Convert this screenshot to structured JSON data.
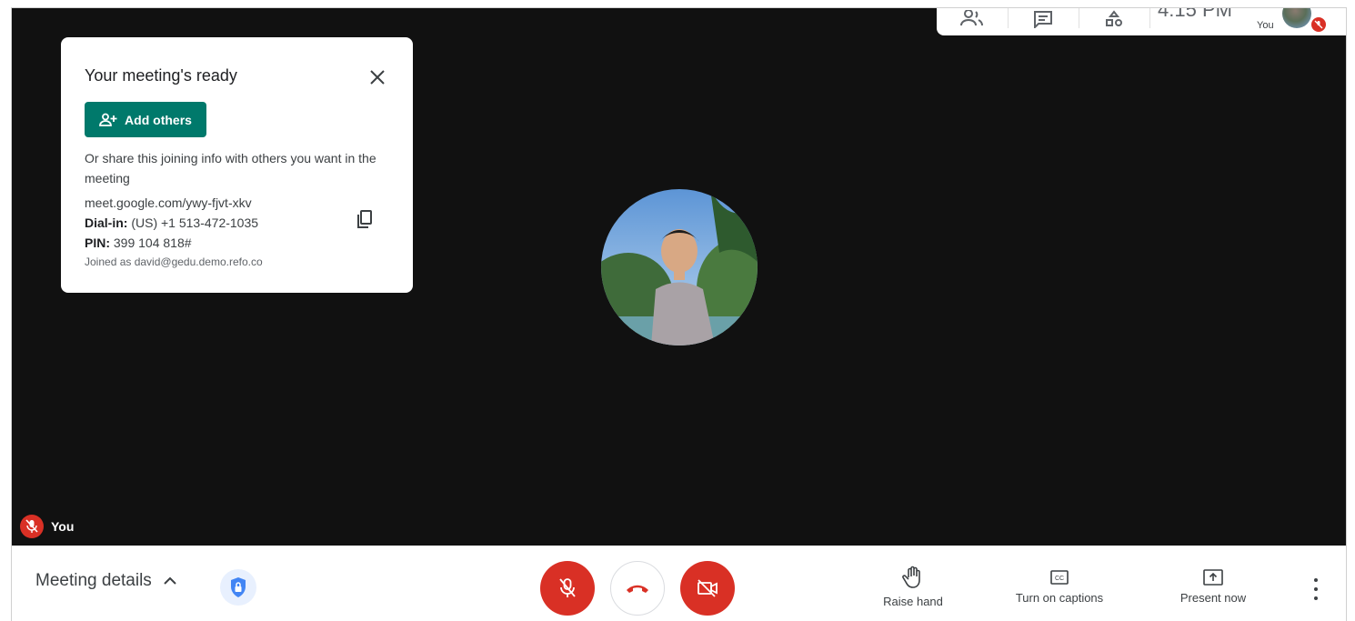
{
  "topbar": {
    "clock": "4:15 PM",
    "self_label": "You"
  },
  "info_card": {
    "title": "Your meeting's ready",
    "add_others_label": "Add others",
    "share_text": "Or share this joining info with others you want in the meeting",
    "meeting_url": "meet.google.com/ywy-fjvt-xkv",
    "dial_in_label": "Dial-in:",
    "dial_in_value": "(US) +1 513-472-1035",
    "pin_label": "PIN:",
    "pin_value": "399 104 818#",
    "joined_as": "Joined as david@gedu.demo.refo.co"
  },
  "stage": {
    "participant_name": "You"
  },
  "bottombar": {
    "meeting_details_label": "Meeting details",
    "raise_hand_label": "Raise hand",
    "captions_label": "Turn on captions",
    "present_label": "Present now"
  },
  "colors": {
    "danger": "#d93025",
    "brand_green": "#00796b",
    "stage_bg": "#111111"
  }
}
